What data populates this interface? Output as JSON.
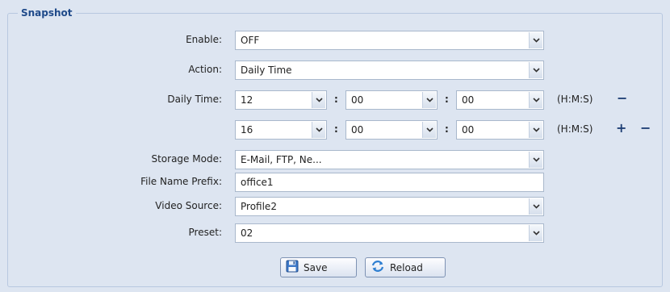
{
  "section": {
    "title": "Snapshot"
  },
  "fields": {
    "enable": {
      "label": "Enable:",
      "value": "OFF"
    },
    "action": {
      "label": "Action:",
      "value": "Daily Time"
    },
    "daily_time": {
      "label": "Daily Time:",
      "rows": [
        {
          "h": "12",
          "m": "00",
          "s": "00",
          "unit": "(H:M:S)"
        },
        {
          "h": "16",
          "m": "00",
          "s": "00",
          "unit": "(H:M:S)"
        }
      ],
      "colon": ":",
      "plus": "+",
      "minus": "−"
    },
    "storage_mode": {
      "label": "Storage Mode:",
      "value": "E-Mail, FTP, Ne..."
    },
    "file_name_prefix": {
      "label": "File Name Prefix:",
      "value": "office1"
    },
    "video_source": {
      "label": "Video Source:",
      "value": "Profile2"
    },
    "preset": {
      "label": "Preset:",
      "value": "02"
    }
  },
  "buttons": {
    "save": "Save",
    "reload": "Reload"
  },
  "icons": {
    "dropdown": "chevron-down-icon",
    "save": "floppy-disk-icon",
    "reload": "refresh-icon"
  },
  "colors": {
    "background": "#dde5f1",
    "legend": "#1f4a8a",
    "border": "#a9b8cc"
  }
}
